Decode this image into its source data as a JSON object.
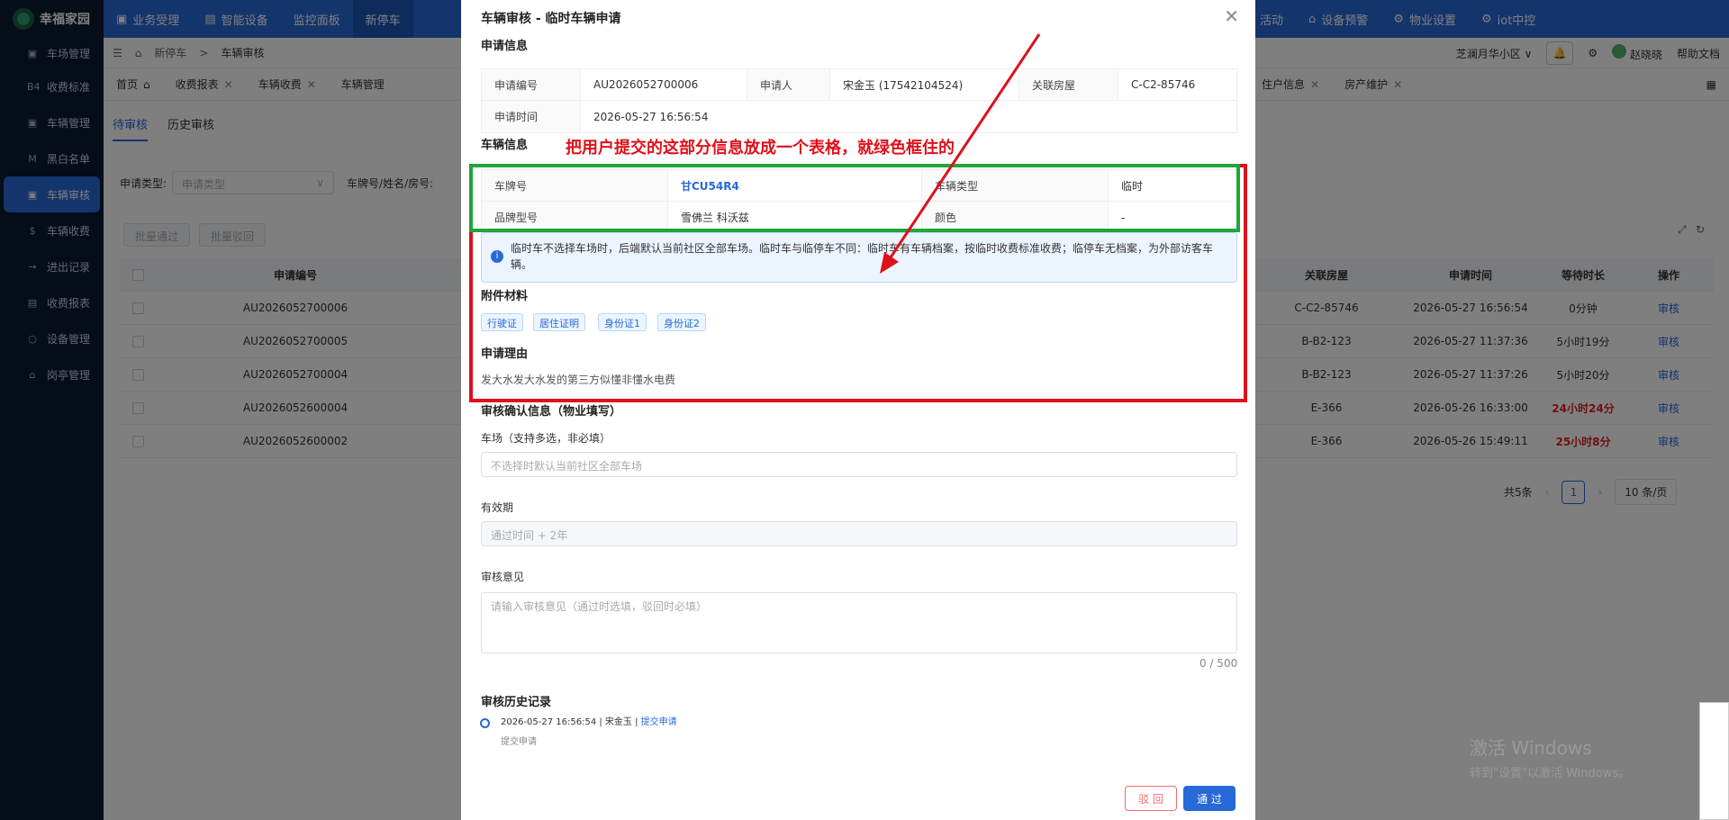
{
  "app": {
    "name": "幸福家园"
  },
  "sidebar": {
    "items": [
      {
        "icon": "B4",
        "label": "收费标准"
      },
      {
        "icon": "▣",
        "label": "车辆管理"
      },
      {
        "icon": "M",
        "label": "黑白名单"
      },
      {
        "icon": "▣",
        "label": "车辆审核"
      },
      {
        "icon": "$",
        "label": "车辆收费"
      },
      {
        "icon": "→",
        "label": "进出记录"
      },
      {
        "icon": "▤",
        "label": "收费报表"
      },
      {
        "icon": "○",
        "label": "设备管理"
      },
      {
        "icon": "⌂",
        "label": "岗亭管理"
      }
    ],
    "first_item": "车场管理"
  },
  "topnav": {
    "items": [
      "业务受理",
      "智能设备",
      "监控面板",
      "新停车"
    ],
    "right_items": [
      "活动",
      "设备预警",
      "物业设置",
      "iot中控"
    ]
  },
  "bar2": {
    "breadcrumb_parent": "新停车",
    "breadcrumb_current": "车辆审核",
    "community": "芝澜月华小区",
    "user": "赵晓晓",
    "help": "帮助文档"
  },
  "tabs": {
    "left": [
      "首页",
      "收费报表",
      "车辆收费",
      "车辆管理"
    ],
    "right": [
      "住户信息",
      "房产维护"
    ]
  },
  "content": {
    "subtabs": [
      "待审核",
      "历史审核"
    ],
    "filter_type_label": "申请类型:",
    "filter_type_placeholder": "申请类型",
    "filter_plate_label": "车牌号/姓名/房号:",
    "btn_batch_pass": "批量通过",
    "btn_batch_reject": "批量驳回",
    "table": {
      "headers": {
        "no": "申请编号",
        "room": "关联房屋",
        "time": "申请时间",
        "wait": "等待时长",
        "op": "操作"
      },
      "rows": [
        {
          "no": "AU2026052700006",
          "room": "C-C2-85746",
          "time": "2026-05-27 16:56:54",
          "wait": "0分钟",
          "op": "审核",
          "alert": false
        },
        {
          "no": "AU2026052700005",
          "room": "B-B2-123",
          "time": "2026-05-27 11:37:36",
          "wait": "5小时19分",
          "op": "审核",
          "alert": false
        },
        {
          "no": "AU2026052700004",
          "room": "B-B2-123",
          "time": "2026-05-27 11:37:26",
          "wait": "5小时20分",
          "op": "审核",
          "alert": false
        },
        {
          "no": "AU2026052600004",
          "room": "E-366",
          "time": "2026-05-26 16:33:00",
          "wait": "24小时24分",
          "op": "审核",
          "alert": true
        },
        {
          "no": "AU2026052600002",
          "room": "E-366",
          "time": "2026-05-26 15:49:11",
          "wait": "25小时8分",
          "op": "审核",
          "alert": true
        }
      ]
    },
    "pager": {
      "total": "共5条",
      "page": "1",
      "size": "10 条/页"
    }
  },
  "modal": {
    "title": "车辆审核 - 临时车辆申请",
    "sec_apply": "申请信息",
    "apply": {
      "no_label": "申请编号",
      "no": "AU2026052700006",
      "applicant_label": "申请人",
      "applicant": "宋金玉 (17542104524)",
      "room_label": "关联房屋",
      "room": "C-C2-85746",
      "time_label": "申请时间",
      "time": "2026-05-27 16:56:54"
    },
    "sec_vehicle": "车辆信息",
    "vehicle": {
      "plate_label": "车牌号",
      "plate": "甘CU54R4",
      "type_label": "车辆类型",
      "type": "临时",
      "brand_label": "品牌型号",
      "brand": "雪佛兰 科沃兹",
      "color_label": "颜色",
      "color": "-"
    },
    "notice": "临时车不选择车场时，后端默认当前社区全部车场。临时车与临停车不同：临时车有车辆档案，按临时收费标准收费；临停车无档案，为外部访客车辆。",
    "sec_attach": "附件材料",
    "attachments": [
      "行驶证",
      "居住证明",
      "身份证1",
      "身份证2"
    ],
    "sec_reason": "申请理由",
    "reason": "发大水发大水发的第三方似懂非懂水电费",
    "sec_confirm": "审核确认信息（物业填写）",
    "lot_label": "车场（支持多选，非必填）",
    "lot_placeholder": "不选择时默认当前社区全部车场",
    "validity_label": "有效期",
    "validity_placeholder": "通过时间 + 2年",
    "opinion_label": "审核意见",
    "opinion_placeholder": "请输入审核意见（通过时选填，驳回时必填）",
    "counter": "0 / 500",
    "sec_history": "审核历史记录",
    "history_time": "2026-05-27 16:56:54 | 宋金玉 | ",
    "history_action": "提交申请",
    "history_sub": "提交申请",
    "btn_reject": "驳 回",
    "btn_pass": "通 过"
  },
  "annotation": {
    "text": "把用户提交的这部分信息放成一个表格，就绿色框住的",
    "green": "#22a53a",
    "red": "#e0101a"
  },
  "windows": {
    "line1": "激活 Windows",
    "line2": "转到\"设置\"以激活 Windows。"
  },
  "colors": {
    "primary": "#2869d8",
    "sidebar": "#0b1a33"
  }
}
